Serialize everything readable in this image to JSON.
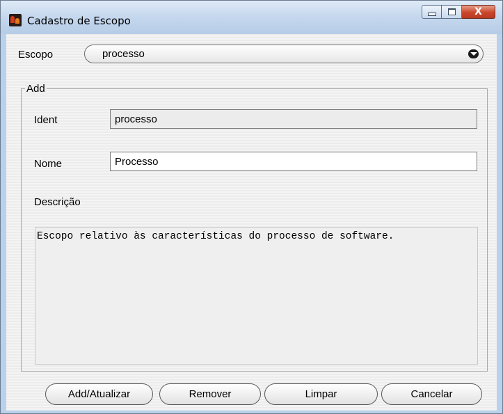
{
  "window": {
    "title": "Cadastro de Escopo",
    "close_glyph": "X"
  },
  "scope": {
    "label": "Escopo",
    "selected": "processo"
  },
  "group": {
    "legend": "Add"
  },
  "fields": {
    "ident_label": "Ident",
    "ident_value": "processo",
    "nome_label": "Nome",
    "nome_value": "Processo",
    "descricao_label": "Descrição",
    "descricao_value": "Escopo relativo às características do processo de software."
  },
  "buttons": {
    "add": "Add/Atualizar",
    "remove": "Remover",
    "clear": "Limpar",
    "cancel": "Cancelar"
  },
  "colors": {
    "title_bar": "#c4d7ee",
    "close_button": "#c9462b",
    "client_bg": "#eeeeee"
  }
}
